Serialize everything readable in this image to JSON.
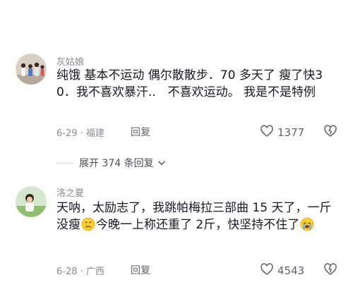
{
  "comments": [
    {
      "username": "灰姑娘",
      "text": "纯饿 基本不运动 偶尔散散步．70 多天了 瘦了快30．我不喜欢暴汗..　不喜欢运动。 我是不是特例",
      "date_location": "6-29 · 福建",
      "reply_label": "回复",
      "likes": "1377",
      "icons": [
        "heart-icon",
        "broken-heart-icon"
      ]
    },
    {
      "username": "洛之夏",
      "text_part1": "天呐，太励志了，我跳帕梅拉三部曲 15 天了，一斤没瘦",
      "text_part2": "今晚一上称还重了 2斤，快坚持不住了",
      "date_location": "6-28 · 广西",
      "reply_label": "回复",
      "likes": "4543",
      "icons": [
        "crying-face-emoji",
        "loudly-crying-face-emoji",
        "heart-icon",
        "broken-heart-icon"
      ]
    }
  ],
  "expand_replies": {
    "label": "展开 374 条回复",
    "icon": "chevron-down-icon"
  },
  "colors": {
    "text_primary": "#161823",
    "text_secondary": "#8a8b91",
    "reply": "#61646c"
  }
}
